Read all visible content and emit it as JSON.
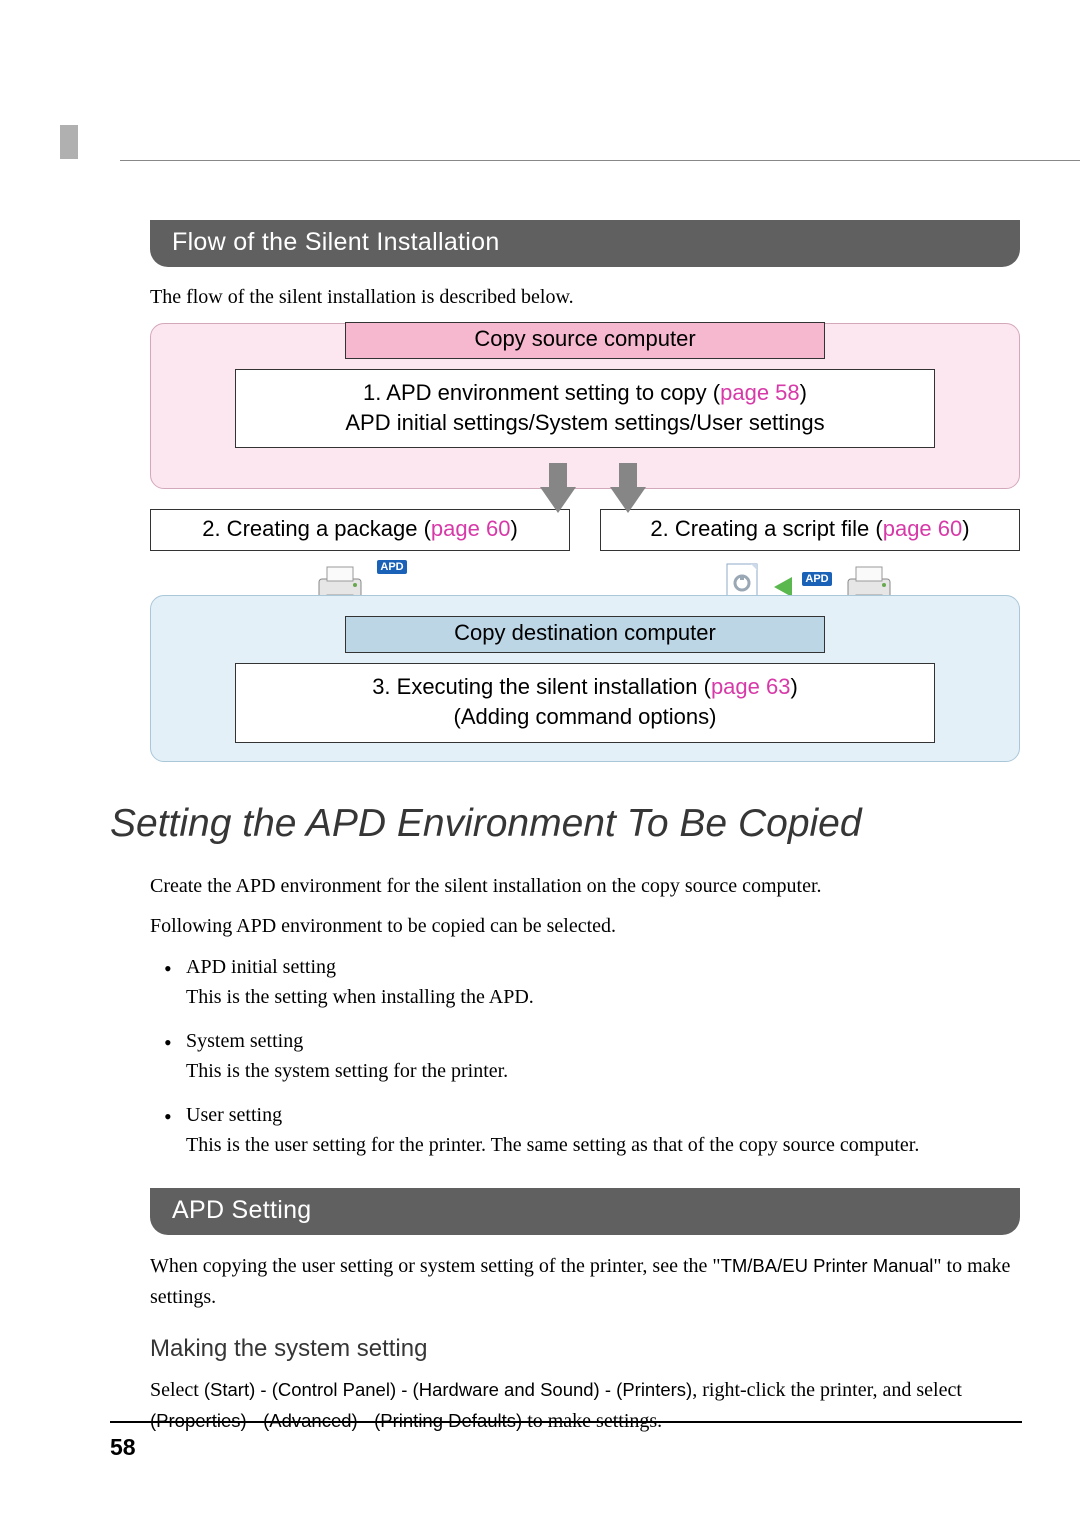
{
  "page_number": "58",
  "section1_title": "Flow of the Silent Installation",
  "intro1": "The flow of the silent installation is described below.",
  "diagram": {
    "src_label": "Copy source computer",
    "src_line1_prefix": "1. APD environment setting to copy (",
    "src_line1_link": "page 58",
    "src_line1_suffix": ")",
    "src_line2": "APD initial settings/System settings/User settings",
    "left_box_prefix": "2. Creating a package (",
    "left_box_link": "page 60",
    "left_box_suffix": ")",
    "right_box_prefix": "2. Creating a script file (",
    "right_box_link": "page 60",
    "right_box_suffix": ")",
    "dst_label": "Copy destination computer",
    "dst_line1_prefix": "3. Executing the silent installation (",
    "dst_line1_link": "page 63",
    "dst_line1_suffix": ")",
    "dst_line2": "(Adding command options)",
    "apd_badge": "APD"
  },
  "main_heading": "Setting the APD Environment To Be Copied",
  "para1": "Create the APD environment for the silent installation on the copy source computer.",
  "para2": "Following APD environment to be copied can be selected.",
  "bullets": [
    {
      "head": "APD initial setting",
      "body": "This is the setting when installing the APD."
    },
    {
      "head": "System setting",
      "body": "This is the system setting for the printer."
    },
    {
      "head": "User setting",
      "body": "This is the user setting for the printer. The same setting as that of the copy source computer."
    }
  ],
  "section2_title": "APD Setting",
  "apd_para_a": "When copying the user setting or system setting of the printer, see the \"",
  "apd_para_manual": "TM/BA/EU Printer Manual",
  "apd_para_b": "\" to make settings.",
  "subsub_title": "Making the system setting",
  "steps_select": "Select ",
  "steps_path1": "(Start) - (Control Panel) - (Hardware and Sound) - (Printers)",
  "steps_mid": ", right-click the printer, and ",
  "steps_select2": "select ",
  "steps_path2": "(Properties) - (Advanced) - (Printing Defaults)",
  "steps_end": " to make settings."
}
